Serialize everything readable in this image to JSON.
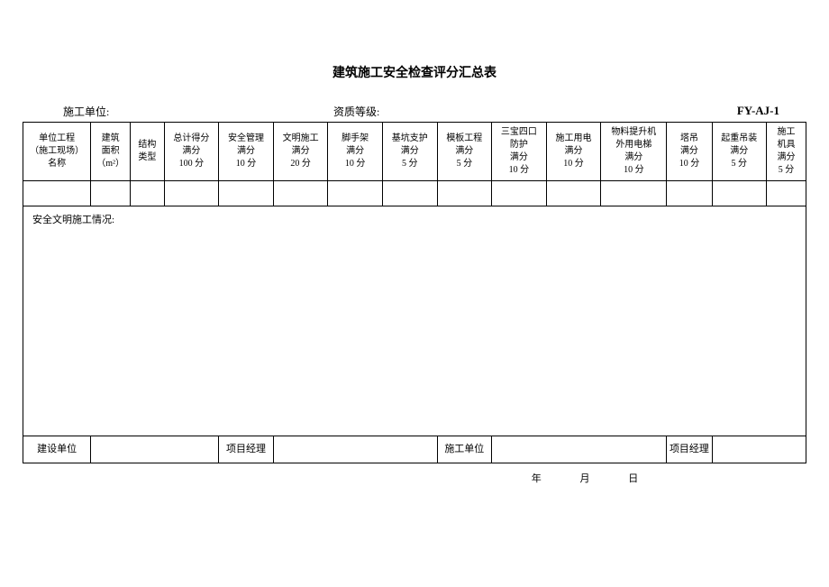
{
  "title": "建筑施工安全检查评分汇总表",
  "top": {
    "construction_unit_label": "施工单位:",
    "qualification_label": "资质等级:",
    "form_code": "FY-AJ-1"
  },
  "headers": [
    "单位工程\n（施工现场）\n名称",
    "建筑\n面积\n（m²）",
    "结构\n类型",
    "总计得分\n满分\n100 分",
    "安全管理\n满分\n10 分",
    "文明施工\n满分\n20 分",
    "脚手架\n满分\n10 分",
    "基坑支护\n满分\n5 分",
    "模板工程\n满分\n5 分",
    "三宝四口\n防护\n满分\n10 分",
    "施工用电\n满分\n10 分",
    "物料提升机\n外用电梯\n满分\n10 分",
    "塔吊\n满分\n10 分",
    "起重吊装\n满分\n5 分",
    "施工\n机具\n满分\n5 分"
  ],
  "situation_label": "安全文明施工情况:",
  "footer": {
    "builder_label": "建设单位",
    "pm_label_1": "项目经理",
    "construction_label": "施工单位",
    "pm_label_2": "项目经理"
  },
  "date": {
    "year": "年",
    "month": "月",
    "day": "日"
  }
}
